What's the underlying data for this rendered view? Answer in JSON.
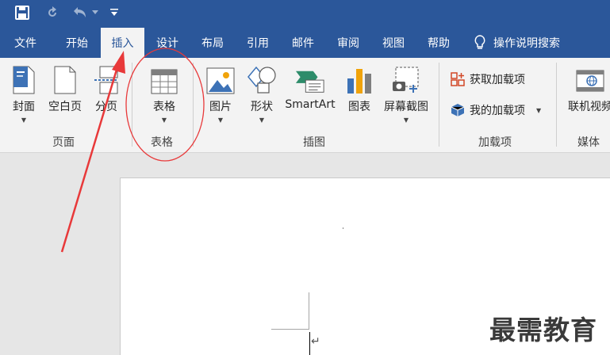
{
  "menu_tabs": [
    "文件",
    "开始",
    "插入",
    "设计",
    "布局",
    "引用",
    "邮件",
    "审阅",
    "视图",
    "帮助"
  ],
  "active_tab": "插入",
  "tell_me": "操作说明搜索",
  "ribbon": {
    "pages_group": {
      "label": "页面",
      "buttons": [
        "封面",
        "空白页",
        "分页"
      ]
    },
    "table_group": {
      "label": "表格",
      "button": "表格"
    },
    "illustrations_group": {
      "label": "插图",
      "buttons": [
        "图片",
        "形状",
        "SmartArt",
        "图表",
        "屏幕截图"
      ]
    },
    "addins_group": {
      "label": "加载项",
      "get_addins": "获取加载项",
      "my_addins": "我的加载项"
    },
    "media_group": {
      "label": "媒体",
      "online_video": "联机视频"
    }
  },
  "watermark": "最需教育",
  "colors": {
    "brand": "#2b579a",
    "annotation": "#e8393a"
  }
}
